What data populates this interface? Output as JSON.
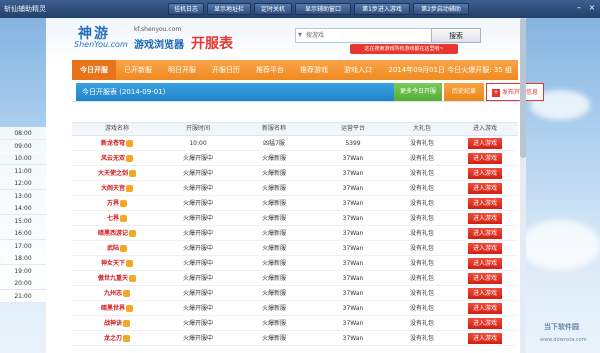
{
  "window": {
    "title": "斩仙辅助精灵",
    "toolbar": [
      "挂机日志",
      "显示地址栏",
      "定时关机",
      "显示辅助窗口",
      "第1步进入游戏",
      "第2步启动辅助"
    ],
    "controls": [
      "–",
      "×"
    ]
  },
  "header": {
    "logo_cn": "神游",
    "logo_en": "ShenYou.com",
    "site": "kf.shenyou.com",
    "slogan_1": "游戏浏览器",
    "slogan_2": "开服表",
    "search_placeholder": "搜游戏",
    "search_button": "搜索",
    "search_tip": "这在搜索游戏所有游戏都在这里哦~"
  },
  "nav": {
    "tabs": [
      "今日开服",
      "已开新服",
      "明日开服",
      "开服日历",
      "推荐平台",
      "推荐游戏",
      "游戏入口"
    ],
    "date_text": "2014年09月01日 今日火爆开服: 35 组"
  },
  "subbar": {
    "title": "今日开服表 (2014-09-01)",
    "more": "更多今日开服",
    "history": "历史纪录",
    "publish": "发布开服信息",
    "publish_icon": "+"
  },
  "table": {
    "headers": [
      "游戏名称",
      "开服时间",
      "新服名称",
      "运营平台",
      "大礼包",
      "进入游戏"
    ],
    "rows": [
      {
        "time": "08:00",
        "game": "新龙苍穹",
        "hot": true,
        "open": "10:00",
        "server": "凶猛7服",
        "platform": "5399",
        "gift": "没有礼包",
        "enter": "进入游戏"
      },
      {
        "time": "09:00",
        "game": "风云无双",
        "hot": true,
        "open": "火爆开服中",
        "server": "火爆新服",
        "platform": "37Wan",
        "gift": "没有礼包",
        "enter": "进入游戏"
      },
      {
        "time": "10:00",
        "game": "大天使之剑",
        "hot": true,
        "open": "火爆开服中",
        "server": "火爆新服",
        "platform": "37Wan",
        "gift": "没有礼包",
        "enter": "进入游戏"
      },
      {
        "time": "11:00",
        "game": "大闹天宫",
        "hot": true,
        "open": "火爆开服中",
        "server": "火爆新服",
        "platform": "37Wan",
        "gift": "没有礼包",
        "enter": "进入游戏"
      },
      {
        "time": "12:00",
        "game": "万界",
        "hot": true,
        "open": "火爆开服中",
        "server": "火爆新服",
        "platform": "37Wan",
        "gift": "没有礼包",
        "enter": "进入游戏"
      },
      {
        "time": "13:00",
        "game": "七界",
        "hot": true,
        "open": "火爆开服中",
        "server": "火爆新服",
        "platform": "37Wan",
        "gift": "没有礼包",
        "enter": "进入游戏"
      },
      {
        "time": "14:00",
        "game": "暗黑西游记",
        "hot": true,
        "open": "火爆开服中",
        "server": "火爆新服",
        "platform": "37Wan",
        "gift": "没有礼包",
        "enter": "进入游戏"
      },
      {
        "time": "15:00",
        "game": "武陆",
        "hot": true,
        "open": "火爆开服中",
        "server": "火爆新服",
        "platform": "37Wan",
        "gift": "没有礼包",
        "enter": "进入游戏"
      },
      {
        "time": "16:00",
        "game": "神女天下",
        "hot": true,
        "open": "火爆开服中",
        "server": "火爆新服",
        "platform": "37Wan",
        "gift": "没有礼包",
        "enter": "进入游戏"
      },
      {
        "time": "17:00",
        "game": "傲世九重天",
        "hot": true,
        "open": "火爆开服中",
        "server": "火爆新服",
        "platform": "37Wan",
        "gift": "没有礼包",
        "enter": "进入游戏"
      },
      {
        "time": "18:00",
        "game": "九州志",
        "hot": true,
        "open": "火爆开服中",
        "server": "火爆新服",
        "platform": "37Wan",
        "gift": "没有礼包",
        "enter": "进入游戏"
      },
      {
        "time": "19:00",
        "game": "暗黑世界",
        "hot": true,
        "open": "火爆开服中",
        "server": "火爆新服",
        "platform": "37Wan",
        "gift": "没有礼包",
        "enter": "进入游戏"
      },
      {
        "time": "20:00",
        "game": "战神诀",
        "hot": true,
        "open": "火爆开服中",
        "server": "火爆新服",
        "platform": "37Wan",
        "gift": "没有礼包",
        "enter": "进入游戏"
      },
      {
        "time": "21:00",
        "game": "龙之刃",
        "hot": true,
        "open": "火爆开服中",
        "server": "火爆新服",
        "platform": "37Wan",
        "gift": "没有礼包",
        "enter": "进入游戏"
      }
    ]
  },
  "watermark": {
    "text": "当下软件园",
    "url": "www.downxia.com"
  },
  "colors": {
    "accent": "#f08a1e",
    "blue": "#1f82c8",
    "red": "#d11f10"
  }
}
